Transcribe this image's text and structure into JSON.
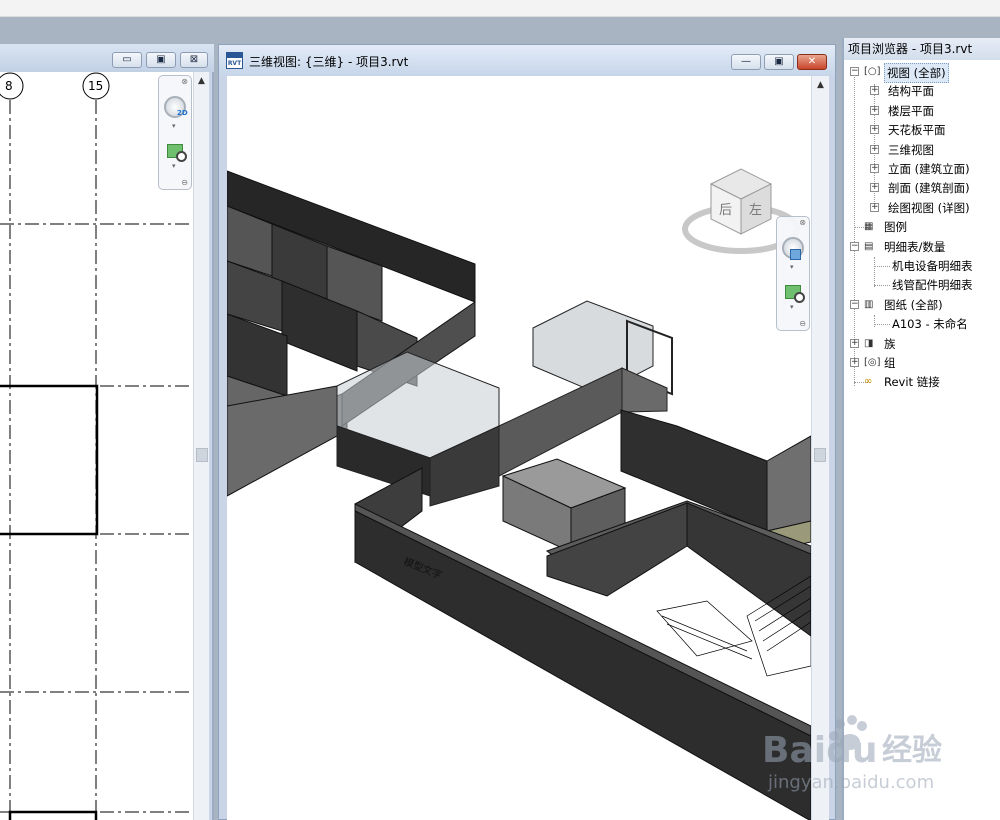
{
  "left_view": {
    "grid_bubbles": [
      "8",
      "15"
    ],
    "buttons": {
      "minimize": "▭",
      "restore": "▣",
      "close": "⊠"
    }
  },
  "main_view": {
    "title": "三维视图: {三维} - 项目3.rvt",
    "icon_text": "RVT",
    "buttons": {
      "minimize": "—",
      "restore": "▣",
      "close": "✕"
    },
    "viewcube": {
      "face_back": "后",
      "face_left": "左"
    },
    "model_text": "模型文字"
  },
  "project_browser": {
    "title": "项目浏览器 - 项目3.rvt",
    "nodes": [
      {
        "label": "视图 (全部)",
        "level": 0,
        "expanded": true,
        "icon": "views-icon"
      },
      {
        "label": "结构平面",
        "level": 1,
        "expanded": false
      },
      {
        "label": "楼层平面",
        "level": 1,
        "expanded": false
      },
      {
        "label": "天花板平面",
        "level": 1,
        "expanded": false
      },
      {
        "label": "三维视图",
        "level": 1,
        "expanded": false
      },
      {
        "label": "立面 (建筑立面)",
        "level": 1,
        "expanded": false
      },
      {
        "label": "剖面 (建筑剖面)",
        "level": 1,
        "expanded": false
      },
      {
        "label": "绘图视图 (详图)",
        "level": 1,
        "expanded": false
      },
      {
        "label": "图例",
        "level": 0,
        "expanded": null,
        "icon": "legend-icon"
      },
      {
        "label": "明细表/数量",
        "level": 0,
        "expanded": true,
        "icon": "schedule-icon"
      },
      {
        "label": "机电设备明细表",
        "level": 1,
        "expanded": null
      },
      {
        "label": "线管配件明细表",
        "level": 1,
        "expanded": null
      },
      {
        "label": "图纸 (全部)",
        "level": 0,
        "expanded": true,
        "icon": "sheets-icon"
      },
      {
        "label": "A103 - 未命名",
        "level": 1,
        "expanded": null
      },
      {
        "label": "族",
        "level": 0,
        "expanded": false,
        "icon": "families-icon"
      },
      {
        "label": "组",
        "level": 0,
        "expanded": false,
        "icon": "groups-icon"
      },
      {
        "label": "Revit 链接",
        "level": 0,
        "expanded": null,
        "icon": "revit-links-icon"
      }
    ]
  },
  "watermark": {
    "brand": "Baidu",
    "suffix": "经验",
    "url": "jingyan.baidu.com"
  }
}
